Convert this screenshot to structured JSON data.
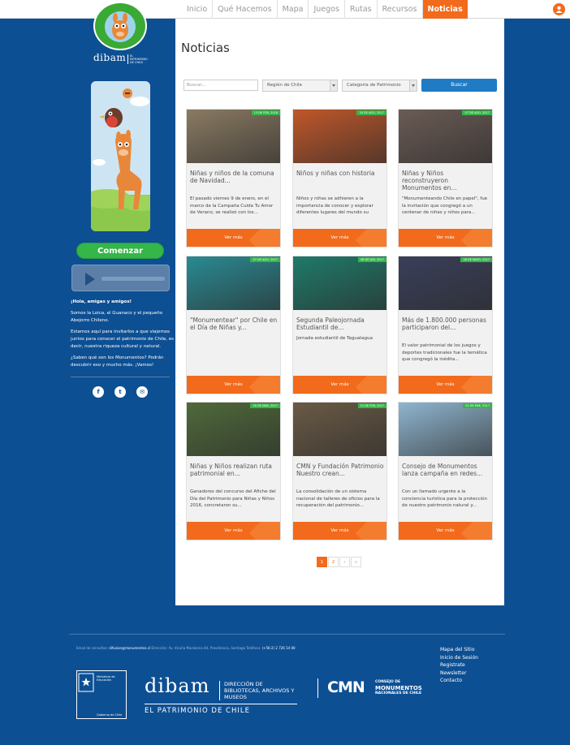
{
  "nav": {
    "items": [
      "Inicio",
      "Qué Hacemos",
      "Mapa",
      "Juegos",
      "Rutas",
      "Recursos",
      "Noticias"
    ],
    "active": "Noticias"
  },
  "logo": {
    "badge_top": "PATRIMONIO",
    "badge_bottom": "NIÑAS Y NIÑOS",
    "dibam": "dibam",
    "dibam_sub": "EL PATRIMONIO DE CHILE"
  },
  "sidebar": {
    "start_button": "Comenzar",
    "greeting": "¡Hola, amigas y amigos!",
    "paragraph1": "Somos la Loica, el Guanaco y el pequeño Abejorro Chileno.",
    "paragraph2": "Estamos aquí para invitarlos a que viajemos juntos para conocer el patrimonio de Chile, es decir, nuestra riqueza cultural y natural.",
    "paragraph3": "¿Saben qué son los Monumentos? Podrán descubrir eso y mucho más. ¡Vamos!",
    "social": [
      {
        "icon": "facebook-icon",
        "glyph": "f"
      },
      {
        "icon": "twitter-icon",
        "glyph": "t"
      },
      {
        "icon": "email-icon",
        "glyph": "✉"
      }
    ]
  },
  "main": {
    "title": "Noticias",
    "search_placeholder": "Buscar...",
    "region_select": "Región de Chile",
    "category_select": "Categoría de Patrimonio",
    "search_button": "Buscar",
    "read_more": "Ver más",
    "cards": [
      {
        "date": "13 DE FEB, 2018",
        "title": "Niñas y niños de la comuna de Navidad...",
        "text": "El pasado viernes 9 de enero, en el marco de la Campaña Cuida Tu Amor de Verano, se realizó con los...",
        "img_color": "#8a7a62"
      },
      {
        "date": "30 DE AGO, 2017",
        "title": "Niños y niñas con historia",
        "text": "Niños y niñas se adhieren a la importancia de conocer y explorar diferentes lugares  del mundo su",
        "img_color": "#c0572a"
      },
      {
        "date": "07 DE AGO, 2017",
        "title": "Niñas y Niños reconstruyeron Monumentos en...",
        "text": "\"Monumenteando Chile en papel\", fue la invitación que congregó a un centenar de niñas y niños para...",
        "img_color": "#6a5b55"
      },
      {
        "date": "07 DE AGO, 2017",
        "title": "\"Monumentear\" por Chile en el Día de Niñas y...",
        "text": "",
        "img_color": "#2a8a92"
      },
      {
        "date": "08 DE JUN, 2017",
        "title": "Segunda Paleojornada Estudiantil de...",
        "text": "Jornada estudiantil de Taguatagua",
        "img_color": "#1f7a6a"
      },
      {
        "date": "28 DE MAYO, 2017",
        "title": "Más de 1.800.000 personas participaron del...",
        "text": "El valor patrimonial de los juegos y deportes tradicionales fue la temática que congregó la inédita...",
        "img_color": "#3a3f5a"
      },
      {
        "date": "30 DE MAR, 2017",
        "title": "Niñas y Niños realizan ruta patrimonial en...",
        "text": "Ganadores del concurso del Afiche del Día del Patrimonio para Niñas y Niños 2016, concretaron su...",
        "img_color": "#4f6a3a"
      },
      {
        "date": "21 DE FEB, 2017",
        "title": "CMN y Fundación Patrimonio Nuestro crean...",
        "text": "La consolidación de un sistema nacional de talleres de oficios para la recuperación del patrimonio...",
        "img_color": "#6a5a45"
      },
      {
        "date": "02 DE ENE, 2017",
        "title": "Consejo de Monumentos lanza campaña en redes...",
        "text": "Con un llamado urgente a la conciencia turística para la protección de nuestro patrimonio natural y...",
        "img_color": "#8fb5cf"
      }
    ],
    "pagination": [
      "1",
      "2",
      "›",
      "»"
    ],
    "current_page": "1"
  },
  "footer": {
    "email_label": "Email de consultas:",
    "email": "difusion@monumentos.cl",
    "address_label": "Dirección:",
    "address": "Av. Vicuña Mackenna 84, Providencia, Santiago",
    "phone_label": "Teléfono:",
    "phone": "(+56-2) 2 726 14 00",
    "links": [
      "Mapa del Sitio",
      "Inicio de Sesión",
      "Registrate",
      "Newsletter",
      "Contacto"
    ],
    "gob_title": "Ministerio de Educación",
    "gob_bottom": "Gobierno de Chile",
    "dibam": "dibam",
    "dibam_sub": "DIRECCIÓN DE BIBLIOTECAS, ARCHIVOS Y MUSEOS",
    "dibam_tag": "EL PATRIMONIO DE CHILE",
    "cmn": "CMN",
    "cmn_sub1": "CONSEJO DE",
    "cmn_sub2": "MONUMENTOS",
    "cmn_sub3": "NACIONALES DE CHILE"
  }
}
